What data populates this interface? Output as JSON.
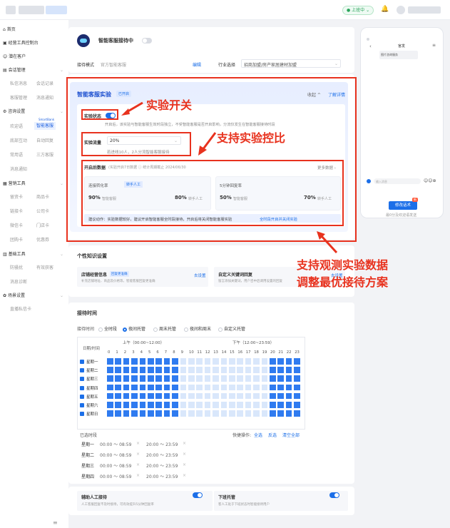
{
  "topbar": {
    "status": "上班中",
    "status_arrow": "⌄"
  },
  "sidebar": {
    "groups": [
      {
        "label": "首页"
      },
      {
        "label": "经营工具控制台"
      },
      {
        "label": "潜在客户"
      },
      {
        "label": "会话管理",
        "items": [
          "私信消息",
          "会话记录",
          "客服管理",
          "消息通知"
        ]
      },
      {
        "label": "咨询设置",
        "items": [
          "欢迎语",
          "智能客服",
          "底部互动",
          "自动回复",
          "常用语",
          "三方客服",
          "消息通知"
        ],
        "tag": "SmartBank"
      },
      {
        "label": "营销工具",
        "items": [
          "留资卡",
          "商品卡",
          "链接卡",
          "公司卡",
          "微信卡",
          "门店卡",
          "团购卡",
          "优惠券"
        ]
      },
      {
        "label": "基础工具",
        "items": [
          "防骚扰",
          "有效获客",
          "消息诊断"
        ]
      },
      {
        "label": "场景设置",
        "items": [
          "直播私信卡"
        ]
      }
    ],
    "collapse_icon": "≡"
  },
  "header": {
    "title": "智能客服接待中",
    "mode_label": "接待模式",
    "mode_value": "官方智能客服",
    "edit": "编辑",
    "industry_label": "行业选择",
    "industry_value": "招商加盟/房产家居建材加盟"
  },
  "experiment": {
    "title": "智能客服实验",
    "badge": "已开启",
    "collapse": "收起 ^",
    "learn_more": "了解详情",
    "status_label": "实验状态",
    "status_desc": "开启后，该实验与智能客服生效时段独立，不受智能客服是否开启影响，分流仅发生在智能客服接待时段",
    "traffic_label": "实验流量",
    "traffic_value": "20%",
    "traffic_hint": "若进线10人，2人分流智能客服接待",
    "data_title": "开启后数据",
    "data_sub": "(实验开启7日数据 ⓘ 统计周期截止 2024/06/30",
    "more_data": "更多数据 ›",
    "group_a": "智能客服",
    "group_b": "转手人工",
    "m1_title": "连接转化率",
    "m1_a": "90%",
    "m1_b": "80%",
    "m2_title": "5分钟回复率",
    "m2_a": "50%",
    "m2_b": "70%",
    "suggest": "建议动作：实验数据较好，建议开启智能客服全时段接待，开启后将关闭智能客服实验",
    "suggest_link": "全时段开启并关闭实验"
  },
  "callouts": {
    "c1": "实验开关",
    "c2": "支持实验控比",
    "c3_line1": "支持观测实验数据",
    "c3_line2": "调整最优接待方案"
  },
  "knowledge": {
    "title": "个性知识设置",
    "item1_title": "店铺经营信息",
    "item1_badge": "回复更准确",
    "item1_desc": "补充店铺地址、商品及价格等，智能客服回复更准确",
    "item1_action": "去设置",
    "item2_title": "自定义关键词回复",
    "item2_desc": "留言添加关键词，用户咨中后调用设置的回复",
    "item2_action": "去设置"
  },
  "schedule": {
    "title": "接待时间",
    "mode_label": "接待时间",
    "modes": [
      "全时段",
      "夜间托管",
      "周末托管",
      "夜间和周末",
      "自定义托管"
    ],
    "selected_mode": 1,
    "col_header": "日期/时间",
    "am": "上午（00:00~12:00）",
    "pm": "下午（12:00~23:59）",
    "hours": [
      "0",
      "1",
      "2",
      "3",
      "4",
      "5",
      "6",
      "7",
      "8",
      "9",
      "10",
      "11",
      "12",
      "13",
      "14",
      "15",
      "16",
      "17",
      "18",
      "19",
      "20",
      "21",
      "22",
      "23"
    ],
    "days": [
      "星期一",
      "星期二",
      "星期三",
      "星期四",
      "星期五",
      "星期六",
      "星期日"
    ],
    "selected_label": "已选时段",
    "quick_label": "快捷操作:",
    "select_all": "全选",
    "invert": "反选",
    "clear": "清空全部",
    "slots": [
      {
        "day": "星期一",
        "a": "00:00 ～ 08:59",
        "b": "20:00 ～ 23:59"
      },
      {
        "day": "星期二",
        "a": "00:00 ～ 08:59",
        "b": "20:00 ～ 23:59"
      },
      {
        "day": "星期三",
        "a": "00:00 ～ 08:59",
        "b": "20:00 ～ 23:59"
      },
      {
        "day": "星期四",
        "a": "00:00 ～ 08:59",
        "b": "20:00 ～ 23:59"
      }
    ]
  },
  "bottom": {
    "assist_title": "辅助人工接待",
    "assist_desc": "人工客服回复不及时接待，可有效提升5分钟回复率",
    "offwork_title": "下班托管",
    "offwork_desc": "客人工处于下班状态时智能接待用户"
  },
  "phone": {
    "title": "官发",
    "bubble": "图片咨询服务",
    "input_placeholder": "输入消息",
    "button": "修改话术",
    "button_badge": "新",
    "hint": "最0分及欢迎语发送"
  },
  "colors": {
    "accent": "#1c6fe8",
    "annotation": "#e8321e"
  }
}
